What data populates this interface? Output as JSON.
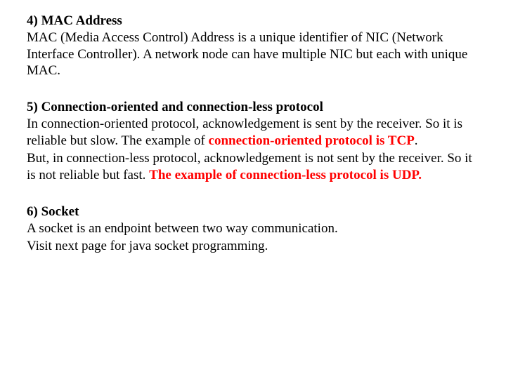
{
  "sections": {
    "s4": {
      "heading": "4) MAC Address",
      "body": "MAC (Media Access Control) Address is a unique identifier of NIC (Network Interface Controller). A network node can have multiple NIC but each with unique MAC."
    },
    "s5": {
      "heading": "5) Connection-oriented and connection-less protocol",
      "p1_plain": "In connection-oriented protocol, acknowledgement is sent by the receiver. So it is reliable but slow. The example of ",
      "p1_em": "connection-oriented protocol is TCP",
      "p1_tail": ".",
      "p2_plain": "But, in connection-less protocol, acknowledgement is not sent by the receiver. So it is not reliable but fast. ",
      "p2_em": "The example of connection-less protocol is UDP."
    },
    "s6": {
      "heading": "6) Socket",
      "line1": "A socket is an endpoint between two way communication.",
      "line2": "Visit next page for java socket programming."
    }
  }
}
